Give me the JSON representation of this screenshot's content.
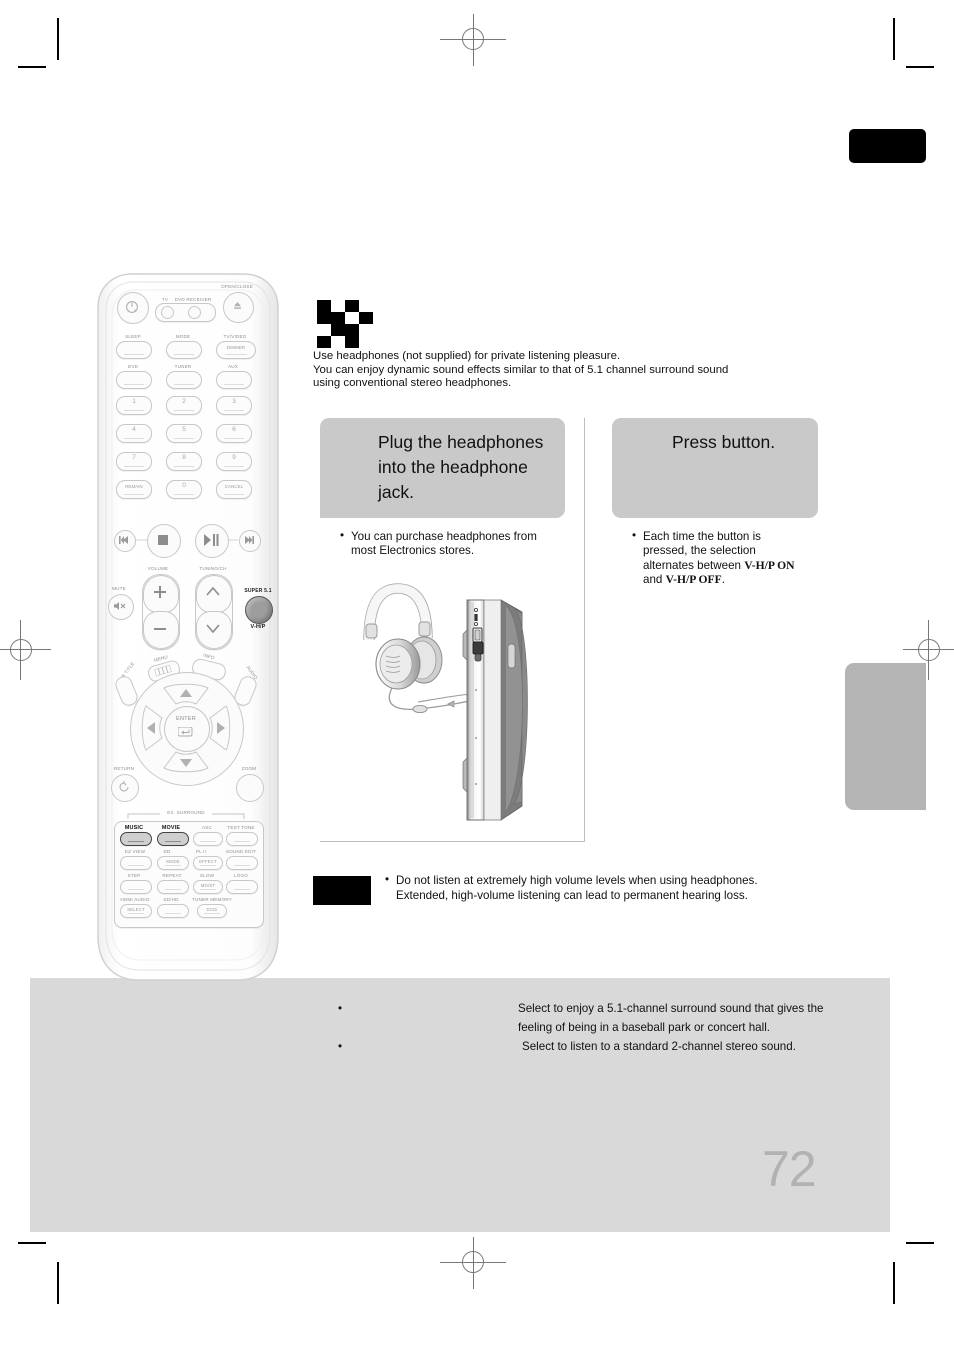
{
  "page": {
    "number": "72",
    "band_color": "#d9d9d9",
    "tab_black_color": "#000000",
    "tab_gray_color": "#b4b4b4"
  },
  "intro": {
    "line1": "Use headphones (not supplied) for private listening pleasure.",
    "line2": "You can enjoy dynamic sound effects similar to that of 5.1 channel surround sound",
    "line3": "using conventional stereo headphones."
  },
  "steps": [
    {
      "heading": "Plug the headphones into the headphone jack.",
      "bullet": "You can purchase headphones from most Electronics stores.",
      "figure_name": "headphones-plugged-into-jack-illustration"
    },
    {
      "heading": "Press button.",
      "bullet_prefix": "Each time the button is pressed, the selection alternates between ",
      "bullet_bold1": "V-H/P ON",
      "bullet_mid": " and ",
      "bullet_bold2": "V-H/P OFF",
      "bullet_suffix": "."
    }
  ],
  "note": {
    "line1": "Do not listen at extremely high volume levels when using headphones.",
    "line2": "Extended, high-volume listening can lead to permanent hearing loss."
  },
  "band_items": [
    {
      "label": "",
      "desc": "Select to enjoy a 5.1-channel surround sound that gives the feeling of being in a baseball park or concert hall."
    },
    {
      "label": "",
      "desc": "Select to listen to a standard 2-channel stereo sound."
    }
  ],
  "remote": {
    "open_close": "OPEN/CLOSE",
    "tv": "TV",
    "dvd_receiver": "DVD RECEIVER",
    "row_sleep": [
      "SLEEP",
      "MODE",
      "TV/VIDEO"
    ],
    "dimmer": "DIMMER",
    "row_source": [
      "DVD",
      "TUNER",
      "AUX"
    ],
    "keypad": [
      "1",
      "2",
      "3",
      "4",
      "5",
      "6",
      "7",
      "8",
      "9"
    ],
    "keypad_bottom": [
      "REMAIN",
      "0",
      "CANCEL"
    ],
    "volume": "VOLUME",
    "tuning": "TUNING/CH",
    "mute": "MUTE",
    "super51": "SUPER 5.1",
    "vhp": "V-H/P",
    "menu": "MENU",
    "info": "INFO",
    "subtitle": "SUB TITLE",
    "audio": "AUDIO",
    "enter": "ENTER",
    "return": "RETURN",
    "zoom": "ZOOM",
    "ex_surround": "EX. SURROUND",
    "grid_r1": [
      "MUSIC",
      "MOVIE",
      "ASC",
      "TEST TONE"
    ],
    "grid_r2_labels": [
      "EZ VIEW",
      "DD",
      "PL II",
      "SOUND EDIT"
    ],
    "grid_r2_btns": [
      "MODE",
      "EFFECT"
    ],
    "grid_r3": [
      "STEP",
      "REPEAT",
      "SLOW",
      "LOGO"
    ],
    "grid_r3_btn": "MO/ST",
    "grid_r4_labels": [
      "HDMI AUDIO",
      "SD/HD",
      "TUNER MEMORY"
    ],
    "grid_r4_btns": [
      "SELECT",
      "DCDi"
    ]
  }
}
